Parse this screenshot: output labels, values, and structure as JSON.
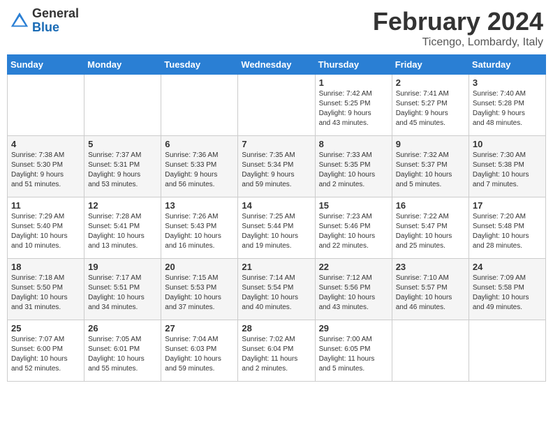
{
  "logo": {
    "general": "General",
    "blue": "Blue"
  },
  "header": {
    "month": "February 2024",
    "location": "Ticengo, Lombardy, Italy"
  },
  "weekdays": [
    "Sunday",
    "Monday",
    "Tuesday",
    "Wednesday",
    "Thursday",
    "Friday",
    "Saturday"
  ],
  "weeks": [
    [
      {
        "day": "",
        "info": ""
      },
      {
        "day": "",
        "info": ""
      },
      {
        "day": "",
        "info": ""
      },
      {
        "day": "",
        "info": ""
      },
      {
        "day": "1",
        "info": "Sunrise: 7:42 AM\nSunset: 5:25 PM\nDaylight: 9 hours\nand 43 minutes."
      },
      {
        "day": "2",
        "info": "Sunrise: 7:41 AM\nSunset: 5:27 PM\nDaylight: 9 hours\nand 45 minutes."
      },
      {
        "day": "3",
        "info": "Sunrise: 7:40 AM\nSunset: 5:28 PM\nDaylight: 9 hours\nand 48 minutes."
      }
    ],
    [
      {
        "day": "4",
        "info": "Sunrise: 7:38 AM\nSunset: 5:30 PM\nDaylight: 9 hours\nand 51 minutes."
      },
      {
        "day": "5",
        "info": "Sunrise: 7:37 AM\nSunset: 5:31 PM\nDaylight: 9 hours\nand 53 minutes."
      },
      {
        "day": "6",
        "info": "Sunrise: 7:36 AM\nSunset: 5:33 PM\nDaylight: 9 hours\nand 56 minutes."
      },
      {
        "day": "7",
        "info": "Sunrise: 7:35 AM\nSunset: 5:34 PM\nDaylight: 9 hours\nand 59 minutes."
      },
      {
        "day": "8",
        "info": "Sunrise: 7:33 AM\nSunset: 5:35 PM\nDaylight: 10 hours\nand 2 minutes."
      },
      {
        "day": "9",
        "info": "Sunrise: 7:32 AM\nSunset: 5:37 PM\nDaylight: 10 hours\nand 5 minutes."
      },
      {
        "day": "10",
        "info": "Sunrise: 7:30 AM\nSunset: 5:38 PM\nDaylight: 10 hours\nand 7 minutes."
      }
    ],
    [
      {
        "day": "11",
        "info": "Sunrise: 7:29 AM\nSunset: 5:40 PM\nDaylight: 10 hours\nand 10 minutes."
      },
      {
        "day": "12",
        "info": "Sunrise: 7:28 AM\nSunset: 5:41 PM\nDaylight: 10 hours\nand 13 minutes."
      },
      {
        "day": "13",
        "info": "Sunrise: 7:26 AM\nSunset: 5:43 PM\nDaylight: 10 hours\nand 16 minutes."
      },
      {
        "day": "14",
        "info": "Sunrise: 7:25 AM\nSunset: 5:44 PM\nDaylight: 10 hours\nand 19 minutes."
      },
      {
        "day": "15",
        "info": "Sunrise: 7:23 AM\nSunset: 5:46 PM\nDaylight: 10 hours\nand 22 minutes."
      },
      {
        "day": "16",
        "info": "Sunrise: 7:22 AM\nSunset: 5:47 PM\nDaylight: 10 hours\nand 25 minutes."
      },
      {
        "day": "17",
        "info": "Sunrise: 7:20 AM\nSunset: 5:48 PM\nDaylight: 10 hours\nand 28 minutes."
      }
    ],
    [
      {
        "day": "18",
        "info": "Sunrise: 7:18 AM\nSunset: 5:50 PM\nDaylight: 10 hours\nand 31 minutes."
      },
      {
        "day": "19",
        "info": "Sunrise: 7:17 AM\nSunset: 5:51 PM\nDaylight: 10 hours\nand 34 minutes."
      },
      {
        "day": "20",
        "info": "Sunrise: 7:15 AM\nSunset: 5:53 PM\nDaylight: 10 hours\nand 37 minutes."
      },
      {
        "day": "21",
        "info": "Sunrise: 7:14 AM\nSunset: 5:54 PM\nDaylight: 10 hours\nand 40 minutes."
      },
      {
        "day": "22",
        "info": "Sunrise: 7:12 AM\nSunset: 5:56 PM\nDaylight: 10 hours\nand 43 minutes."
      },
      {
        "day": "23",
        "info": "Sunrise: 7:10 AM\nSunset: 5:57 PM\nDaylight: 10 hours\nand 46 minutes."
      },
      {
        "day": "24",
        "info": "Sunrise: 7:09 AM\nSunset: 5:58 PM\nDaylight: 10 hours\nand 49 minutes."
      }
    ],
    [
      {
        "day": "25",
        "info": "Sunrise: 7:07 AM\nSunset: 6:00 PM\nDaylight: 10 hours\nand 52 minutes."
      },
      {
        "day": "26",
        "info": "Sunrise: 7:05 AM\nSunset: 6:01 PM\nDaylight: 10 hours\nand 55 minutes."
      },
      {
        "day": "27",
        "info": "Sunrise: 7:04 AM\nSunset: 6:03 PM\nDaylight: 10 hours\nand 59 minutes."
      },
      {
        "day": "28",
        "info": "Sunrise: 7:02 AM\nSunset: 6:04 PM\nDaylight: 11 hours\nand 2 minutes."
      },
      {
        "day": "29",
        "info": "Sunrise: 7:00 AM\nSunset: 6:05 PM\nDaylight: 11 hours\nand 5 minutes."
      },
      {
        "day": "",
        "info": ""
      },
      {
        "day": "",
        "info": ""
      }
    ]
  ]
}
